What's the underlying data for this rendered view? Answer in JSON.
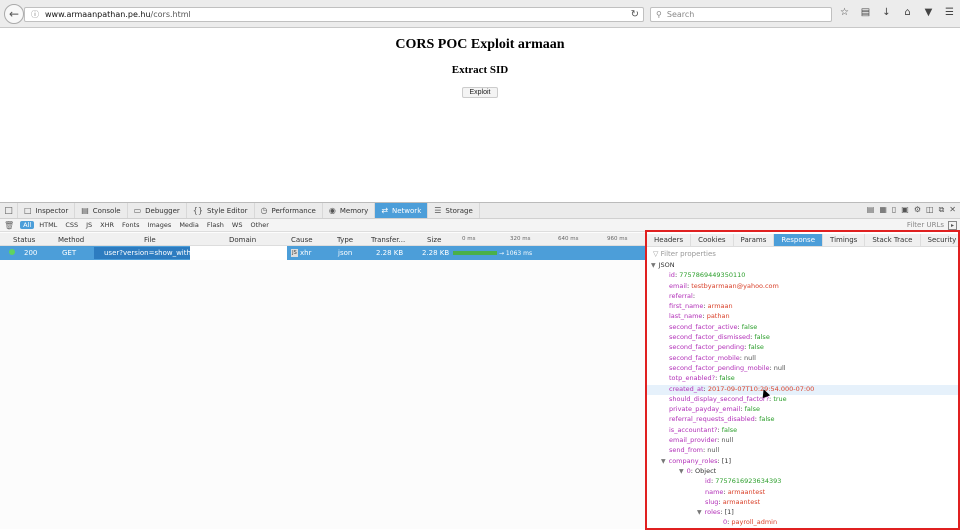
{
  "browser": {
    "url_host": "www.armaanpathan.pe.hu",
    "url_path": "/cors.html",
    "search_placeholder": "Search"
  },
  "page": {
    "title": "CORS POC Exploit armaan",
    "subtitle": "Extract SID",
    "button_label": "Exploit"
  },
  "devtools": {
    "tabs": [
      {
        "label": "Inspector",
        "icon": "inspector-icon"
      },
      {
        "label": "Console",
        "icon": "console-icon"
      },
      {
        "label": "Debugger",
        "icon": "debugger-icon"
      },
      {
        "label": "Style Editor",
        "icon": "style-editor-icon"
      },
      {
        "label": "Performance",
        "icon": "performance-icon"
      },
      {
        "label": "Memory",
        "icon": "memory-icon"
      },
      {
        "label": "Network",
        "icon": "network-icon"
      },
      {
        "label": "Storage",
        "icon": "storage-icon"
      }
    ],
    "active_tab": "Network",
    "filters": [
      "All",
      "HTML",
      "CSS",
      "JS",
      "XHR",
      "Fonts",
      "Images",
      "Media",
      "Flash",
      "WS",
      "Other"
    ],
    "filter_urls_placeholder": "Filter URLs",
    "columns": [
      "Status",
      "Method",
      "File",
      "Domain",
      "Cause",
      "Type",
      "Transfer...",
      "Size",
      "0 ms",
      "320 ms",
      "640 ms",
      "960 ms"
    ],
    "request": {
      "status": "200",
      "method": "GET",
      "file": "user?version=show_with_logins",
      "cause": "xhr",
      "type": "json",
      "transferred": "2.28 KB",
      "size": "2.28 KB",
      "timing": "→ 1063 ms",
      "status_color": "#5fd35f"
    },
    "side_tabs": [
      "Headers",
      "Cookies",
      "Params",
      "Response",
      "Timings",
      "Stack Trace",
      "Security"
    ],
    "active_side_tab": "Response",
    "filter_properties_placeholder": "Filter properties",
    "accent": "#4c9ed9",
    "highlight_border": "#e02020"
  },
  "json_tree": {
    "root": "JSON",
    "fields": [
      {
        "key": "id",
        "value": "7757869449350110",
        "kind": "num",
        "indent": 1
      },
      {
        "key": "email",
        "value": "testbyarmaan@yahoo.com",
        "kind": "str",
        "indent": 1
      },
      {
        "key": "referral",
        "value": "",
        "kind": "str",
        "indent": 1
      },
      {
        "key": "first_name",
        "value": "armaan",
        "kind": "str",
        "indent": 1
      },
      {
        "key": "last_name",
        "value": "pathan",
        "kind": "str",
        "indent": 1
      },
      {
        "key": "second_factor_active",
        "value": "false",
        "kind": "bool",
        "indent": 1
      },
      {
        "key": "second_factor_dismissed",
        "value": "false",
        "kind": "bool",
        "indent": 1
      },
      {
        "key": "second_factor_pending",
        "value": "false",
        "kind": "bool",
        "indent": 1
      },
      {
        "key": "second_factor_mobile",
        "value": "null",
        "kind": "nul",
        "indent": 1
      },
      {
        "key": "second_factor_pending_mobile",
        "value": "null",
        "kind": "nul",
        "indent": 1
      },
      {
        "key": "totp_enabled?",
        "value": "false",
        "kind": "bool",
        "indent": 1
      },
      {
        "key": "created_at",
        "value": "2017-09-07T10:29:54.000-07:00",
        "kind": "str",
        "indent": 1,
        "highlight": true
      },
      {
        "key": "should_display_second_factor?",
        "value": "true",
        "kind": "bool",
        "indent": 1
      },
      {
        "key": "private_payday_email",
        "value": "false",
        "kind": "bool",
        "indent": 1
      },
      {
        "key": "referral_requests_disabled",
        "value": "false",
        "kind": "bool",
        "indent": 1
      },
      {
        "key": "is_accountant?",
        "value": "false",
        "kind": "bool",
        "indent": 1
      },
      {
        "key": "email_provider",
        "value": "null",
        "kind": "nul",
        "indent": 1
      },
      {
        "key": "send_from",
        "value": "null",
        "kind": "nul",
        "indent": 1
      },
      {
        "key": "company_roles",
        "value": "[1]",
        "kind": "obj",
        "indent": 1,
        "expanded": true
      },
      {
        "key": "0",
        "value": "Object",
        "kind": "obj",
        "indent": 2,
        "expanded": true
      },
      {
        "key": "id",
        "value": "7757616923634393",
        "kind": "num",
        "indent": 3
      },
      {
        "key": "name",
        "value": "armaantest",
        "kind": "str",
        "indent": 3
      },
      {
        "key": "slug",
        "value": "armaantest",
        "kind": "str",
        "indent": 3
      },
      {
        "key": "roles",
        "value": "[1]",
        "kind": "obj",
        "indent": 3,
        "expanded": true
      },
      {
        "key": "0",
        "value": "payroll_admin",
        "kind": "str",
        "indent": 4
      }
    ]
  }
}
